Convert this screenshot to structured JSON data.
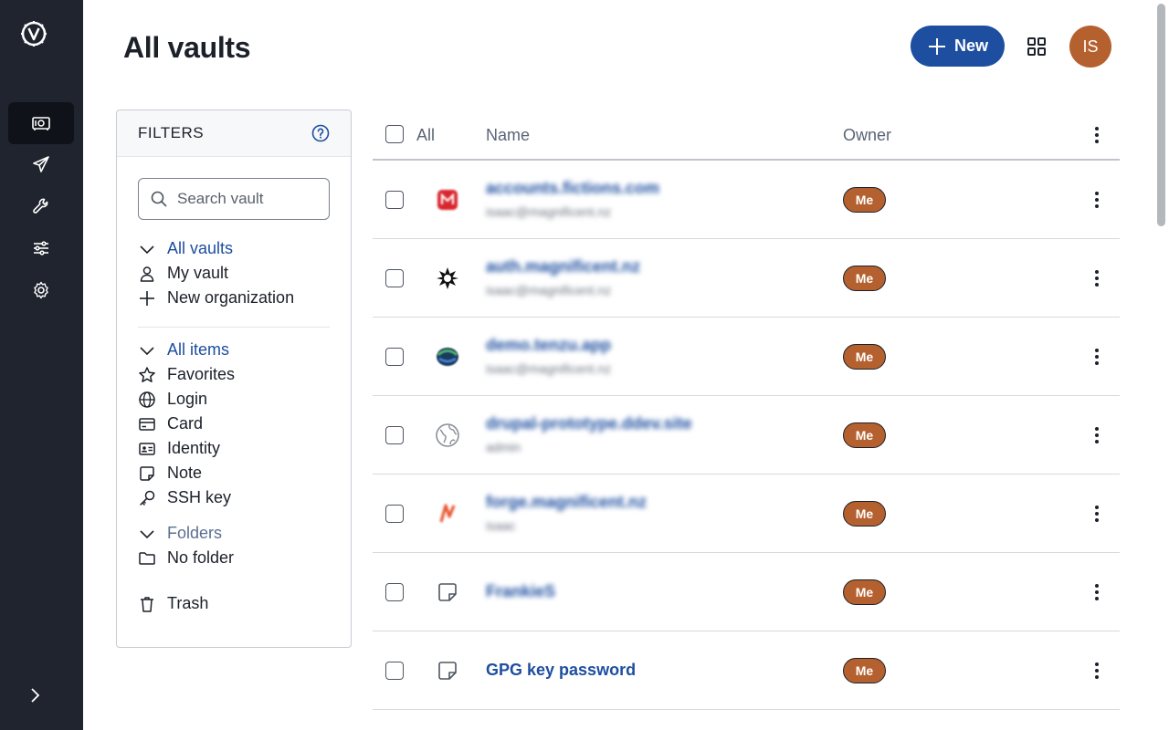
{
  "page": {
    "title": "All vaults"
  },
  "header": {
    "new_label": "New",
    "avatar_initials": "IS"
  },
  "filters": {
    "title": "FILTERS",
    "search_placeholder": "Search vault",
    "vaults": {
      "header": "All vaults",
      "items": [
        {
          "label": "My vault",
          "icon": "user-icon"
        },
        {
          "label": "New organization",
          "icon": "plus-icon"
        }
      ]
    },
    "types": {
      "header": "All items",
      "items": [
        {
          "label": "Favorites",
          "icon": "star-icon"
        },
        {
          "label": "Login",
          "icon": "globe-icon"
        },
        {
          "label": "Card",
          "icon": "card-icon"
        },
        {
          "label": "Identity",
          "icon": "id-card-icon"
        },
        {
          "label": "Note",
          "icon": "note-icon"
        },
        {
          "label": "SSH key",
          "icon": "key-icon"
        }
      ]
    },
    "folders": {
      "header": "Folders",
      "items": [
        {
          "label": "No folder",
          "icon": "folder-icon"
        }
      ]
    },
    "trash": {
      "label": "Trash",
      "icon": "trash-icon"
    }
  },
  "table": {
    "columns": {
      "all": "All",
      "name": "Name",
      "owner": "Owner"
    },
    "rows": [
      {
        "name": "accounts.fictions.com",
        "sub": "isaac@magnificent.nz",
        "icon": "red-m-logo-icon",
        "owner": "Me",
        "blurred": true
      },
      {
        "name": "auth.magnificent.nz",
        "sub": "isaac@magnificent.nz",
        "icon": "star-burst-logo-icon",
        "owner": "Me",
        "blurred": true
      },
      {
        "name": "demo.tenzu.app",
        "sub": "isaac@magnificent.nz",
        "icon": "tenzu-logo-icon",
        "owner": "Me",
        "blurred": true
      },
      {
        "name": "drupal-prototype.ddev.site",
        "sub": "admin",
        "icon": "globe-icon",
        "owner": "Me",
        "blurred": true
      },
      {
        "name": "forge.magnificent.nz",
        "sub": "isaac",
        "icon": "forge-logo-icon",
        "owner": "Me",
        "blurred": true
      },
      {
        "name": "FrankieS",
        "sub": "",
        "icon": "note-icon",
        "owner": "Me",
        "blurred": true
      },
      {
        "name": "GPG key password",
        "sub": "",
        "icon": "note-icon",
        "owner": "Me",
        "blurred": false
      }
    ]
  },
  "colors": {
    "rail_bg": "#1f242e",
    "accent": "#1d4ea0",
    "owner_badge": "#b5602f"
  }
}
